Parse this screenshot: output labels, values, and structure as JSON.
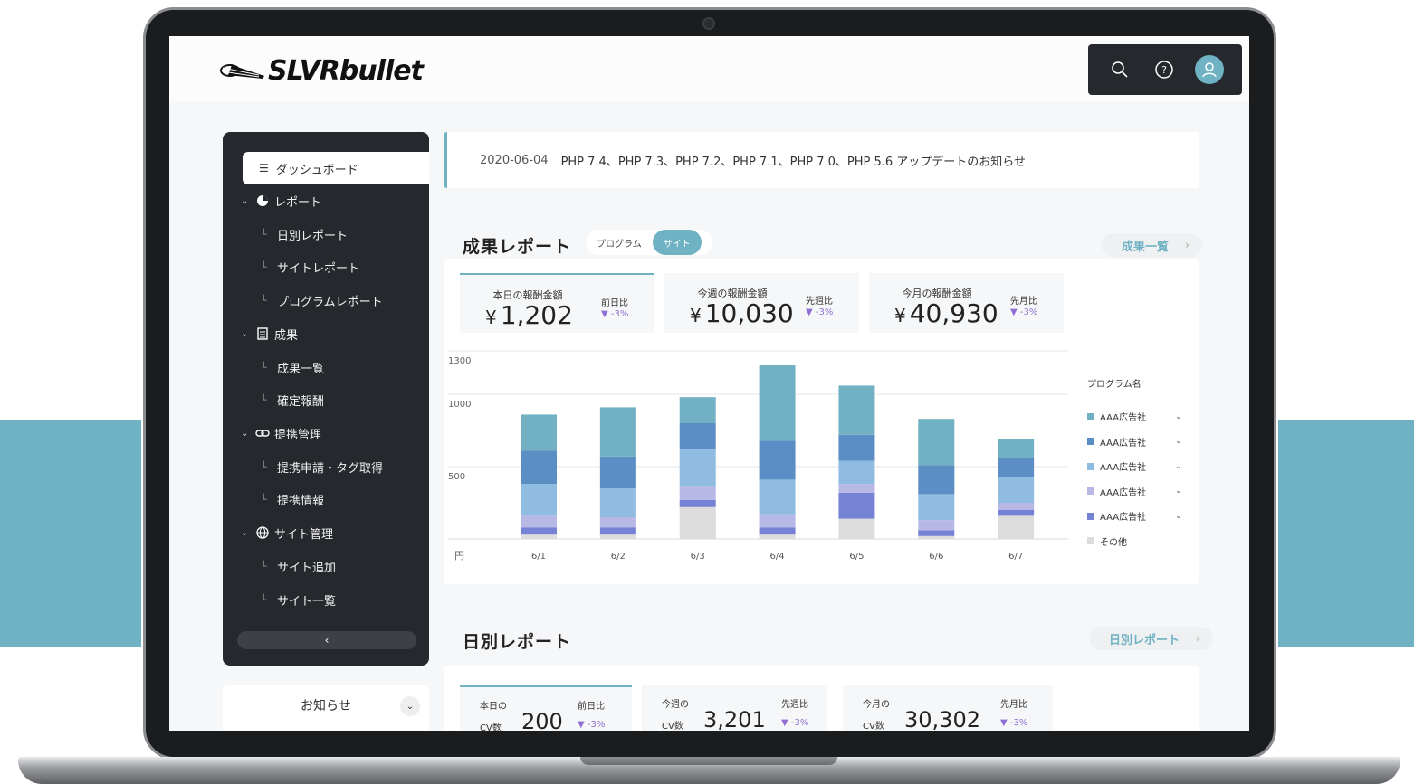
{
  "header": {
    "logo_text": "SLVRbullet",
    "icons": [
      "search-icon",
      "help-icon",
      "user-icon"
    ]
  },
  "sidebar": {
    "active_item": "ダッシュボード",
    "groups": [
      {
        "label": "レポート",
        "icon": "pie-chart-icon",
        "items": [
          "日別レポート",
          "サイトレポート",
          "プログラムレポート"
        ]
      },
      {
        "label": "成果",
        "icon": "clipboard-icon",
        "items": [
          "成果一覧",
          "確定報酬"
        ]
      },
      {
        "label": "提携管理",
        "icon": "link-icon",
        "items": [
          "提携申請・タグ取得",
          "提携情報"
        ]
      },
      {
        "label": "サイト管理",
        "icon": "globe-icon",
        "items": [
          "サイト追加",
          "サイト一覧"
        ]
      }
    ],
    "collapse_label": "‹"
  },
  "notice_panel": {
    "label": "お知らせ"
  },
  "announcement": {
    "date": "2020-06-04",
    "text": "PHP 7.4、PHP 7.3、PHP 7.2、PHP 7.1、PHP 7.0、PHP 5.6 アップデートのお知らせ"
  },
  "results_report": {
    "title": "成果レポート",
    "toggle": [
      "プログラム",
      "サイト"
    ],
    "toggle_selected": "サイト",
    "link": "成果一覧",
    "kpis": [
      {
        "label": "本日の報酬金額",
        "currency": "¥",
        "value": "1,202",
        "compare": "前日比",
        "delta": "▼ -3%"
      },
      {
        "label": "今週の報酬金額",
        "currency": "¥",
        "value": "10,030",
        "compare": "先週比",
        "delta": "▼ -3%"
      },
      {
        "label": "今月の報酬金額",
        "currency": "¥",
        "value": "40,930",
        "compare": "先月比",
        "delta": "▼ -3%"
      }
    ]
  },
  "chart_data": {
    "type": "bar",
    "stacked": true,
    "categories": [
      "6/1",
      "6/2",
      "6/3",
      "6/4",
      "6/5",
      "6/6",
      "6/7"
    ],
    "y_ticks": [
      "1300",
      "1000",
      "500"
    ],
    "y_unit_label": "円",
    "ylim": [
      0,
      1300
    ],
    "grid": true,
    "legend_title": "プログラム名",
    "legend_position": "right",
    "series": [
      {
        "name": "その他",
        "color": "#dcdcdc",
        "values": [
          30,
          30,
          220,
          30,
          140,
          20,
          160
        ]
      },
      {
        "name": "AAA広告社",
        "color": "#7582d6",
        "values": [
          50,
          50,
          50,
          50,
          180,
          40,
          40
        ]
      },
      {
        "name": "AAA広告社",
        "color": "#b7b8e6",
        "values": [
          80,
          70,
          90,
          90,
          60,
          70,
          50
        ]
      },
      {
        "name": "AAA広告社",
        "color": "#8fbce0",
        "values": [
          220,
          200,
          260,
          240,
          160,
          180,
          180
        ]
      },
      {
        "name": "AAA広告社",
        "color": "#5b8ec4",
        "values": [
          230,
          220,
          180,
          270,
          180,
          200,
          130
        ]
      },
      {
        "name": "AAA広告社",
        "color": "#72b1c4",
        "values": [
          250,
          340,
          180,
          520,
          340,
          320,
          130
        ]
      }
    ]
  },
  "daily_report": {
    "title": "日別レポート",
    "link": "日別レポート",
    "kpis": [
      {
        "label": "本日の",
        "cv_label": "CV数",
        "value": "200",
        "compare": "前日比",
        "delta": "▼ -3%"
      },
      {
        "label": "今週の",
        "cv_label": "CV数",
        "value": "3,201",
        "compare": "先週比",
        "delta": "▼ -3%"
      },
      {
        "label": "今月の",
        "cv_label": "CV数",
        "value": "30,302",
        "compare": "先月比",
        "delta": "▼ -3%"
      }
    ]
  }
}
